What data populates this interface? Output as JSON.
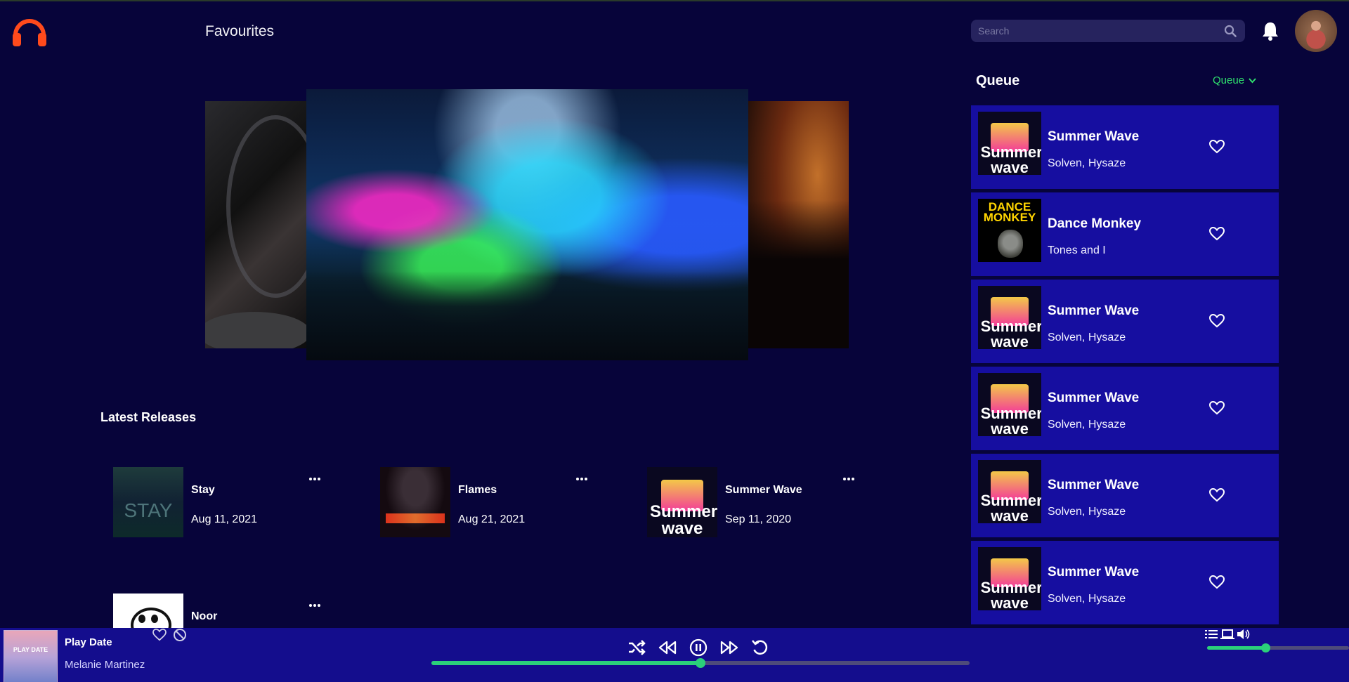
{
  "header": {
    "page_title": "Favourites",
    "search_placeholder": "Search"
  },
  "colors": {
    "background": "#07043a",
    "accent": "#2bd07a",
    "queue_card": "#160ea0",
    "player_bar": "#140d8d",
    "logo": "#ff4a1c"
  },
  "latest_releases": {
    "title": "Latest Releases",
    "items": [
      {
        "title": "Stay",
        "date": "Aug 11, 2021",
        "cover": "stay"
      },
      {
        "title": "Flames",
        "date": "Aug 21, 2021",
        "cover": "flames"
      },
      {
        "title": "Summer Wave",
        "date": "Sep 11, 2020",
        "cover": "summer-wave"
      },
      {
        "title": "Noor",
        "date": "",
        "cover": "panda"
      }
    ]
  },
  "queue": {
    "title": "Queue",
    "dropdown_label": "Queue",
    "items": [
      {
        "title": "Summer Wave",
        "artist": "Solven, Hysaze",
        "cover": "summer-wave"
      },
      {
        "title": "Dance Monkey",
        "artist": "Tones and I",
        "cover": "dance-monkey"
      },
      {
        "title": "Summer Wave",
        "artist": "Solven, Hysaze",
        "cover": "summer-wave"
      },
      {
        "title": "Summer Wave",
        "artist": "Solven, Hysaze",
        "cover": "summer-wave"
      },
      {
        "title": "Summer Wave",
        "artist": "Solven, Hysaze",
        "cover": "summer-wave"
      },
      {
        "title": "Summer Wave",
        "artist": "Solven, Hysaze",
        "cover": "summer-wave"
      }
    ]
  },
  "covers": {
    "summer_wave_text": "Summer wave",
    "dance_monkey_text": "DANCE MONKEY",
    "play_date_text": "PLAY DATE"
  },
  "player": {
    "title": "Play Date",
    "artist": "Melanie Martinez",
    "progress": 0.5,
    "volume": 0.41
  }
}
